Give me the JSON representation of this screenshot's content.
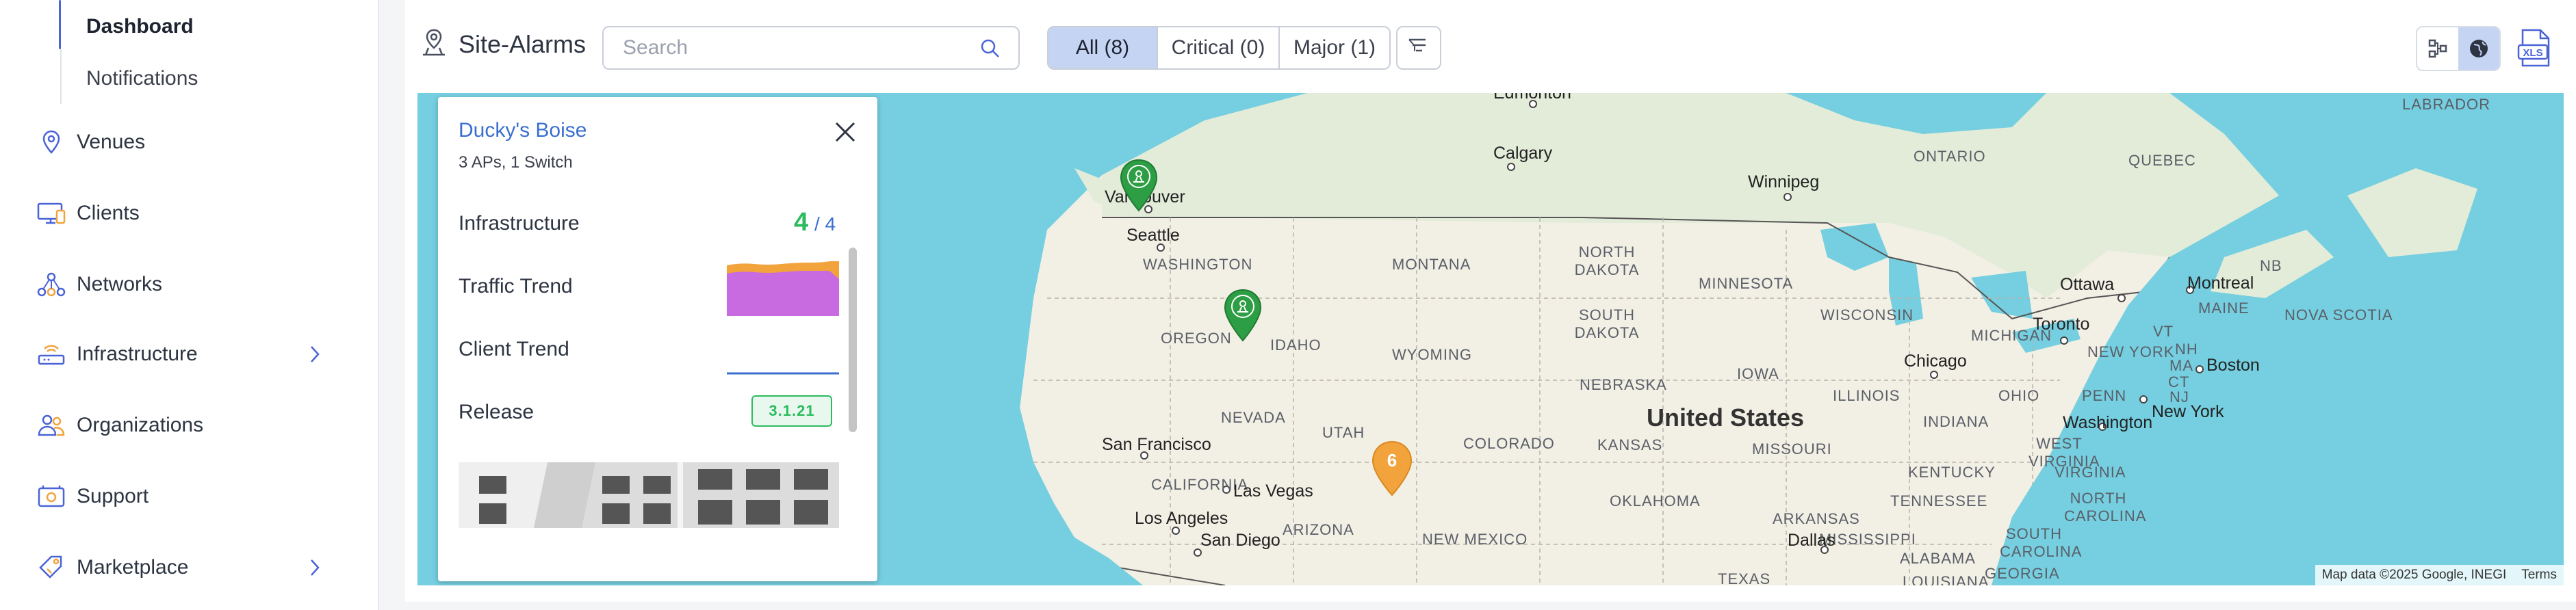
{
  "sidebar": {
    "sub_items": [
      {
        "label": "Dashboard",
        "active": true
      },
      {
        "label": "Notifications",
        "active": false
      }
    ],
    "items": [
      {
        "label": "Venues",
        "icon": "location-pin-icon",
        "has_chevron": false
      },
      {
        "label": "Clients",
        "icon": "monitor-icon",
        "has_chevron": false
      },
      {
        "label": "Networks",
        "icon": "network-icon",
        "has_chevron": false
      },
      {
        "label": "Infrastructure",
        "icon": "router-icon",
        "has_chevron": true
      },
      {
        "label": "Organizations",
        "icon": "users-icon",
        "has_chevron": false
      },
      {
        "label": "Support",
        "icon": "support-icon",
        "has_chevron": false
      },
      {
        "label": "Marketplace",
        "icon": "tag-icon",
        "has_chevron": true
      }
    ]
  },
  "header": {
    "title": "Site-Alarms",
    "search_placeholder": "Search",
    "filters": [
      {
        "label": "All (8)",
        "active": true
      },
      {
        "label": "Critical (0)",
        "active": false
      },
      {
        "label": "Major (1)",
        "active": false
      }
    ],
    "export_label": "XLS"
  },
  "popup": {
    "site_name": "Ducky's Boise",
    "subtitle": "3 APs, 1 Switch",
    "infrastructure_label": "Infrastructure",
    "infrastructure_up": "4",
    "infrastructure_total": "/ 4",
    "traffic_label": "Traffic Trend",
    "client_label": "Client Trend",
    "release_label": "Release",
    "release_value": "3.1.21"
  },
  "map": {
    "country": "United States",
    "cluster_count": "6",
    "attribution": "Map data ©2025 Google, INEGI",
    "terms": "Terms",
    "cities": [
      "Edmonton",
      "Calgary",
      "Vancouver",
      "Seattle",
      "Winnipeg",
      "Ottawa",
      "Montreal",
      "Toronto",
      "Chicago",
      "Boston",
      "New York",
      "Washington",
      "San Francisco",
      "Las Vegas",
      "Los Angeles",
      "San Diego",
      "Dallas"
    ],
    "regions": [
      "LABRADOR",
      "ONTARIO",
      "QUEBEC",
      "WASHINGTON",
      "MONTANA",
      "NORTH DAKOTA",
      "MINNESOTA",
      "OREGON",
      "IDAHO",
      "SOUTH DAKOTA",
      "WISCONSIN",
      "MICHIGAN",
      "WYOMING",
      "NEBRASKA",
      "IOWA",
      "ILLINOIS",
      "OHIO",
      "PENN",
      "NEVADA",
      "UTAH",
      "COLORADO",
      "KANSAS",
      "MISSOURI",
      "INDIANA",
      "KENTUCKY",
      "WEST VIRGINIA",
      "VIRGINIA",
      "CALIFORNIA",
      "ARIZONA",
      "NEW MEXICO",
      "OKLAHOMA",
      "ARKANSAS",
      "TENNESSEE",
      "NORTH CAROLINA",
      "SOUTH CAROLINA",
      "GEORGIA",
      "ALABAMA",
      "MISSISSIPPI",
      "LOUISIANA",
      "TEXAS",
      "NB",
      "NOVA SCOTIA",
      "MAINE",
      "VT",
      "NH",
      "MA",
      "CT",
      "NJ",
      "NEW YORK"
    ]
  },
  "colors": {
    "accent": "#4a63d6",
    "active_segment": "#c6d4f3",
    "ok_green": "#2dbb5e",
    "pin_green": "#2e9e45",
    "cluster_orange": "#f2a33c",
    "water": "#75cfe0",
    "land": "#f2efe4"
  }
}
